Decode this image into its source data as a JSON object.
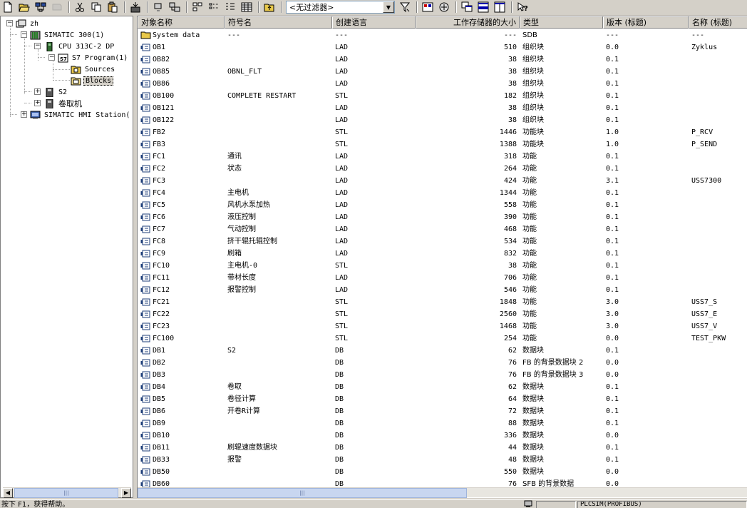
{
  "toolbar": {
    "buttons": [
      "new-icon",
      "open-icon",
      "accessible-nodes-icon",
      "memory-card-icon",
      "cut-icon",
      "copy-icon",
      "paste-icon",
      "download-icon",
      "online-icon",
      "offline-icon",
      "large-icons-icon",
      "small-icons-icon",
      "list-view-icon",
      "details-view-icon",
      "up-one-level-icon",
      "filter-settings-icon",
      "simulation-icon",
      "netpro-icon",
      "tile-icon",
      "split-icon",
      "single-window-icon",
      "whats-this-help-icon"
    ],
    "filter_value": "<无过滤器>"
  },
  "tree": {
    "root": "zh",
    "station": "SIMATIC 300(1)",
    "cpu": "CPU 313C-2 DP",
    "program": "S7 Program(1)",
    "sources": "Sources",
    "blocks": "Blocks",
    "s2": "S2",
    "reel": "卷取机",
    "hmi": "SIMATIC HMI Station("
  },
  "columns": [
    "对象名称",
    "符号名",
    "创建语言",
    "工作存储器的大小",
    "类型",
    "版本 (标题)",
    "名称 (标题)"
  ],
  "rows": [
    {
      "name": "System data",
      "symbol": "---",
      "lang": "---",
      "size": "---",
      "type": "SDB",
      "version": "---",
      "title": "---",
      "icon": "folder"
    },
    {
      "name": "OB1",
      "symbol": "",
      "lang": "LAD",
      "size": "510",
      "type": "组织块",
      "version": "0.0",
      "title": "Zyklus",
      "icon": "block"
    },
    {
      "name": "OB82",
      "symbol": "",
      "lang": "LAD",
      "size": "38",
      "type": "组织块",
      "version": "0.1",
      "title": "",
      "icon": "block"
    },
    {
      "name": "OB85",
      "symbol": "OBNL_FLT",
      "lang": "LAD",
      "size": "38",
      "type": "组织块",
      "version": "0.1",
      "title": "",
      "icon": "block"
    },
    {
      "name": "OB86",
      "symbol": "",
      "lang": "LAD",
      "size": "38",
      "type": "组织块",
      "version": "0.1",
      "title": "",
      "icon": "block"
    },
    {
      "name": "OB100",
      "symbol": "COMPLETE RESTART",
      "lang": "STL",
      "size": "182",
      "type": "组织块",
      "version": "0.1",
      "title": "",
      "icon": "block"
    },
    {
      "name": "OB121",
      "symbol": "",
      "lang": "LAD",
      "size": "38",
      "type": "组织块",
      "version": "0.1",
      "title": "",
      "icon": "block"
    },
    {
      "name": "OB122",
      "symbol": "",
      "lang": "LAD",
      "size": "38",
      "type": "组织块",
      "version": "0.1",
      "title": "",
      "icon": "block"
    },
    {
      "name": "FB2",
      "symbol": "",
      "lang": "STL",
      "size": "1446",
      "type": "功能块",
      "version": "1.0",
      "title": "P_RCV",
      "icon": "block"
    },
    {
      "name": "FB3",
      "symbol": "",
      "lang": "STL",
      "size": "1388",
      "type": "功能块",
      "version": "1.0",
      "title": "P_SEND",
      "icon": "block"
    },
    {
      "name": "FC1",
      "symbol": "通讯",
      "lang": "LAD",
      "size": "318",
      "type": "功能",
      "version": "0.1",
      "title": "",
      "icon": "block"
    },
    {
      "name": "FC2",
      "symbol": "状态",
      "lang": "LAD",
      "size": "264",
      "type": "功能",
      "version": "0.1",
      "title": "",
      "icon": "block"
    },
    {
      "name": "FC3",
      "symbol": "",
      "lang": "LAD",
      "size": "424",
      "type": "功能",
      "version": "3.1",
      "title": "USS7300",
      "icon": "block"
    },
    {
      "name": "FC4",
      "symbol": "主电机",
      "lang": "LAD",
      "size": "1344",
      "type": "功能",
      "version": "0.1",
      "title": "",
      "icon": "block"
    },
    {
      "name": "FC5",
      "symbol": "风机水泵加热",
      "lang": "LAD",
      "size": "558",
      "type": "功能",
      "version": "0.1",
      "title": "",
      "icon": "block"
    },
    {
      "name": "FC6",
      "symbol": "液压控制",
      "lang": "LAD",
      "size": "390",
      "type": "功能",
      "version": "0.1",
      "title": "",
      "icon": "block"
    },
    {
      "name": "FC7",
      "symbol": "气动控制",
      "lang": "LAD",
      "size": "468",
      "type": "功能",
      "version": "0.1",
      "title": "",
      "icon": "block"
    },
    {
      "name": "FC8",
      "symbol": "挤干辊托辊控制",
      "lang": "LAD",
      "size": "534",
      "type": "功能",
      "version": "0.1",
      "title": "",
      "icon": "block"
    },
    {
      "name": "FC9",
      "symbol": "刷箱",
      "lang": "LAD",
      "size": "832",
      "type": "功能",
      "version": "0.1",
      "title": "",
      "icon": "block"
    },
    {
      "name": "FC10",
      "symbol": "主电机-0",
      "lang": "STL",
      "size": "38",
      "type": "功能",
      "version": "0.1",
      "title": "",
      "icon": "block"
    },
    {
      "name": "FC11",
      "symbol": "带材长度",
      "lang": "LAD",
      "size": "706",
      "type": "功能",
      "version": "0.1",
      "title": "",
      "icon": "block"
    },
    {
      "name": "FC12",
      "symbol": "报警控制",
      "lang": "LAD",
      "size": "546",
      "type": "功能",
      "version": "0.1",
      "title": "",
      "icon": "block"
    },
    {
      "name": "FC21",
      "symbol": "",
      "lang": "STL",
      "size": "1848",
      "type": "功能",
      "version": "3.0",
      "title": "USS7_S",
      "icon": "block"
    },
    {
      "name": "FC22",
      "symbol": "",
      "lang": "STL",
      "size": "2560",
      "type": "功能",
      "version": "3.0",
      "title": "USS7_E",
      "icon": "block"
    },
    {
      "name": "FC23",
      "symbol": "",
      "lang": "STL",
      "size": "1468",
      "type": "功能",
      "version": "3.0",
      "title": "USS7_V",
      "icon": "block"
    },
    {
      "name": "FC100",
      "symbol": "",
      "lang": "STL",
      "size": "254",
      "type": "功能",
      "version": "0.0",
      "title": "TEST_PKW",
      "icon": "block"
    },
    {
      "name": "DB1",
      "symbol": "S2",
      "lang": "DB",
      "size": "62",
      "type": "数据块",
      "version": "0.1",
      "title": "",
      "icon": "block"
    },
    {
      "name": "DB2",
      "symbol": "",
      "lang": "DB",
      "size": "76",
      "type": "FB 的背景数据块 2",
      "version": "0.0",
      "title": "",
      "icon": "block"
    },
    {
      "name": "DB3",
      "symbol": "",
      "lang": "DB",
      "size": "76",
      "type": "FB 的背景数据块 3",
      "version": "0.0",
      "title": "",
      "icon": "block"
    },
    {
      "name": "DB4",
      "symbol": "卷取",
      "lang": "DB",
      "size": "62",
      "type": "数据块",
      "version": "0.1",
      "title": "",
      "icon": "block"
    },
    {
      "name": "DB5",
      "symbol": "卷径计算",
      "lang": "DB",
      "size": "64",
      "type": "数据块",
      "version": "0.1",
      "title": "",
      "icon": "block"
    },
    {
      "name": "DB6",
      "symbol": "开卷R计算",
      "lang": "DB",
      "size": "72",
      "type": "数据块",
      "version": "0.1",
      "title": "",
      "icon": "block"
    },
    {
      "name": "DB9",
      "symbol": "",
      "lang": "DB",
      "size": "88",
      "type": "数据块",
      "version": "0.1",
      "title": "",
      "icon": "block"
    },
    {
      "name": "DB10",
      "symbol": "",
      "lang": "DB",
      "size": "336",
      "type": "数据块",
      "version": "0.0",
      "title": "",
      "icon": "block"
    },
    {
      "name": "DB11",
      "symbol": "刷辊速度数据块",
      "lang": "DB",
      "size": "44",
      "type": "数据块",
      "version": "0.1",
      "title": "",
      "icon": "block"
    },
    {
      "name": "DB33",
      "symbol": "报警",
      "lang": "DB",
      "size": "48",
      "type": "数据块",
      "version": "0.1",
      "title": "",
      "icon": "block"
    },
    {
      "name": "DB50",
      "symbol": "",
      "lang": "DB",
      "size": "550",
      "type": "数据块",
      "version": "0.0",
      "title": "",
      "icon": "block"
    },
    {
      "name": "DB60",
      "symbol": "",
      "lang": "DB",
      "size": "76",
      "type": "SFB 的背景数据",
      "version": "0.0",
      "title": "",
      "icon": "block"
    }
  ],
  "status": {
    "help": "按下 F1，获得帮助。",
    "interface": "PLCSIM(PROFIBUS)"
  },
  "colors": {
    "window_bg": "#d4d0c8",
    "selection": "#d4d0c8",
    "scroll_thumb": "#c8d6f0",
    "block_icon": "#1f3f7a"
  }
}
